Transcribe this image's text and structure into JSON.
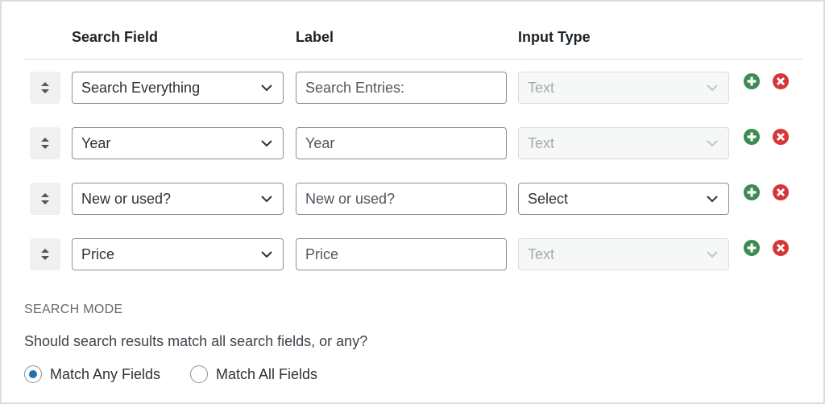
{
  "headers": {
    "search_field": "Search Field",
    "label": "Label",
    "input_type": "Input Type"
  },
  "rows": [
    {
      "search_field": "Search Everything",
      "label": "Search Entries:",
      "input_type": "Text",
      "input_type_disabled": true
    },
    {
      "search_field": "Year",
      "label": "Year",
      "input_type": "Text",
      "input_type_disabled": true
    },
    {
      "search_field": "New or used?",
      "label": "New or used?",
      "input_type": "Select",
      "input_type_disabled": false
    },
    {
      "search_field": "Price",
      "label": "Price",
      "input_type": "Text",
      "input_type_disabled": true
    }
  ],
  "search_mode": {
    "title": "SEARCH MODE",
    "question": "Should search results match all search fields, or any?",
    "options": [
      {
        "label": "Match Any Fields",
        "checked": true
      },
      {
        "label": "Match All Fields",
        "checked": false
      }
    ]
  },
  "colors": {
    "add": "#3c8b4f",
    "remove": "#d63638",
    "radio_accent": "#2271b1"
  },
  "icons": {
    "handle": "sort-arrows-icon",
    "add": "plus-circle-icon",
    "remove": "x-circle-icon",
    "chevron": "chevron-down-icon"
  }
}
